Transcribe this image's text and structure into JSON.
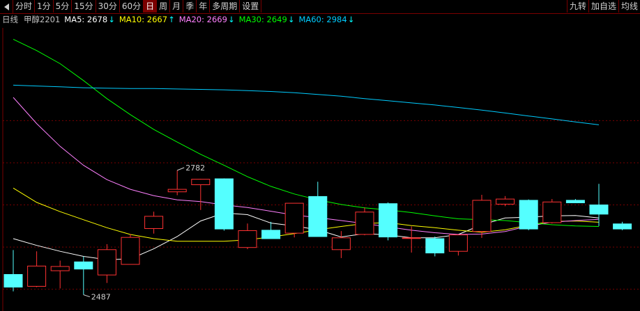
{
  "toolbar": {
    "back_icon": "left-arrow-icon",
    "periods": [
      "分时",
      "1分",
      "5分",
      "15分",
      "30分",
      "60分",
      "日",
      "周",
      "月",
      "季",
      "年",
      "多周期",
      "设置"
    ],
    "active_period": "日",
    "right_buttons": [
      "九转",
      "加自选",
      "均线"
    ]
  },
  "legend": {
    "period": "日线",
    "symbol": "甲醇2201",
    "items": [
      {
        "label": "MA5: 2678",
        "arrow": "↓",
        "color": "#ffffff"
      },
      {
        "label": "MA10: 2667",
        "arrow": "↑",
        "color": "#ffff00"
      },
      {
        "label": "MA20: 2669",
        "arrow": "↓",
        "color": "#ff80ff"
      },
      {
        "label": "MA30: 2649",
        "arrow": "↓",
        "color": "#00ff00"
      },
      {
        "label": "MA60: 2984",
        "arrow": "↓",
        "color": "#00ccff"
      }
    ],
    "arrow_color": "#00ffff"
  },
  "colors": {
    "background": "#000000",
    "grid": "#7a0000",
    "up_candle": "#ff3232",
    "down_candle": "#54ffff",
    "label": "#d0d0d0"
  },
  "chart_data": {
    "type": "candlestick",
    "ylim": [
      2460,
      3120
    ],
    "grid": "dashed horizontal",
    "annotations": [
      {
        "text": "2782",
        "value": 2782,
        "index": 7
      },
      {
        "text": "2487",
        "value": 2487,
        "index": 3
      }
    ],
    "candles": [
      {
        "o": 2535,
        "h": 2593,
        "l": 2495,
        "c": 2505
      },
      {
        "o": 2507,
        "h": 2590,
        "l": 2505,
        "c": 2555
      },
      {
        "o": 2544,
        "h": 2568,
        "l": 2502,
        "c": 2554
      },
      {
        "o": 2565,
        "h": 2578,
        "l": 2487,
        "c": 2548
      },
      {
        "o": 2534,
        "h": 2607,
        "l": 2515,
        "c": 2594
      },
      {
        "o": 2559,
        "h": 2631,
        "l": 2559,
        "c": 2623
      },
      {
        "o": 2644,
        "h": 2684,
        "l": 2632,
        "c": 2673
      },
      {
        "o": 2731,
        "h": 2782,
        "l": 2723,
        "c": 2737
      },
      {
        "o": 2748,
        "h": 2762,
        "l": 2688,
        "c": 2761
      },
      {
        "o": 2762,
        "h": 2763,
        "l": 2639,
        "c": 2643
      },
      {
        "o": 2599,
        "h": 2656,
        "l": 2595,
        "c": 2639
      },
      {
        "o": 2640,
        "h": 2660,
        "l": 2621,
        "c": 2620
      },
      {
        "o": 2633,
        "h": 2701,
        "l": 2623,
        "c": 2704
      },
      {
        "o": 2720,
        "h": 2755,
        "l": 2628,
        "c": 2625
      },
      {
        "o": 2594,
        "h": 2638,
        "l": 2574,
        "c": 2622
      },
      {
        "o": 2630,
        "h": 2694,
        "l": 2628,
        "c": 2683
      },
      {
        "o": 2703,
        "h": 2706,
        "l": 2616,
        "c": 2624
      },
      {
        "o": 2622,
        "h": 2649,
        "l": 2587,
        "c": 2622
      },
      {
        "o": 2620,
        "h": 2625,
        "l": 2578,
        "c": 2586
      },
      {
        "o": 2590,
        "h": 2627,
        "l": 2580,
        "c": 2629
      },
      {
        "o": 2637,
        "h": 2724,
        "l": 2622,
        "c": 2711
      },
      {
        "o": 2702,
        "h": 2721,
        "l": 2697,
        "c": 2714
      },
      {
        "o": 2711,
        "h": 2713,
        "l": 2640,
        "c": 2643
      },
      {
        "o": 2658,
        "h": 2714,
        "l": 2656,
        "c": 2707
      },
      {
        "o": 2711,
        "h": 2714,
        "l": 2705,
        "c": 2705
      },
      {
        "o": 2700,
        "h": 2750,
        "l": 2650,
        "c": 2678
      },
      {
        "o": 2655,
        "h": 2660,
        "l": 2640,
        "c": 2643
      }
    ],
    "series": [
      {
        "name": "MA5",
        "color": "#ffffff",
        "values": [
          2620,
          2604,
          2590,
          2578,
          2570,
          2572,
          2596,
          2625,
          2662,
          2681,
          2677,
          2657,
          2650,
          2641,
          2624,
          2632,
          2629,
          2622,
          2622,
          2630,
          2653,
          2669,
          2671,
          2674,
          2675,
          2669,
          2678
        ]
      },
      {
        "name": "MA10",
        "color": "#ffff00",
        "values": [
          2740,
          2706,
          2684,
          2665,
          2646,
          2630,
          2620,
          2614,
          2614,
          2614,
          2617,
          2624,
          2632,
          2641,
          2649,
          2656,
          2658,
          2651,
          2646,
          2640,
          2635,
          2641,
          2652,
          2661,
          2662,
          2659,
          2667
        ]
      },
      {
        "name": "MA20",
        "color": "#ff80ff",
        "values": [
          2955,
          2893,
          2839,
          2794,
          2760,
          2737,
          2722,
          2712,
          2708,
          2700,
          2694,
          2685,
          2676,
          2670,
          2663,
          2656,
          2648,
          2640,
          2634,
          2630,
          2631,
          2637,
          2650,
          2659,
          2663,
          2666,
          2669
        ]
      },
      {
        "name": "MA30",
        "color": "#00ff00",
        "values": [
          3093,
          3066,
          3035,
          2995,
          2952,
          2914,
          2879,
          2849,
          2820,
          2794,
          2767,
          2744,
          2726,
          2712,
          2701,
          2693,
          2688,
          2682,
          2674,
          2667,
          2665,
          2663,
          2658,
          2653,
          2650,
          2649,
          2649
        ]
      },
      {
        "name": "MA60",
        "color": "#00ccff",
        "values": [
          2984,
          2982,
          2980,
          2978,
          2977,
          2976,
          2976,
          2975,
          2974,
          2973,
          2971,
          2969,
          2966,
          2962,
          2958,
          2952,
          2947,
          2942,
          2937,
          2931,
          2925,
          2918,
          2911,
          2904,
          2897,
          2890,
          2984
        ]
      }
    ]
  }
}
